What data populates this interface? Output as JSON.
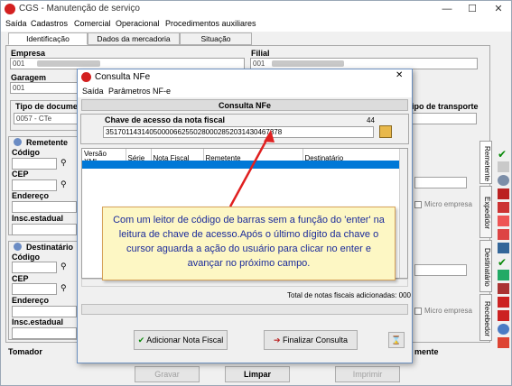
{
  "main_window": {
    "title": "CGS - Manutenção de serviço",
    "menu": [
      "Saída",
      "Cadastros",
      "Comercial",
      "Operacional",
      "Procedimentos auxiliares"
    ],
    "tabs": [
      "Identificação",
      "Dados da mercadoria",
      "Situação"
    ],
    "empresa_label": "Empresa",
    "empresa_value": "001",
    "filial_label": "Filial",
    "filial_value": "001",
    "garagem_label": "Garagem",
    "garagem_value": "001",
    "tipo_documento_label": "Tipo de documen",
    "tipo_documento_value": "0057 - CTe",
    "tipo_transporte_label": "ipo de transporte",
    "remetente_title": "Remetente",
    "destinatario_title": "Destinatário",
    "codigo_label": "Código",
    "cep_label": "CEP",
    "endereco_label": "Endereço",
    "insc_label": "Insc.estadual",
    "micro_empresa_label": "Micro empresa",
    "tomador_label": "Tomador",
    "side_tabs": [
      "Remetente",
      "Expedidor",
      "Destinatário",
      "Recebedor"
    ],
    "buttons": {
      "gravar": "Gravar",
      "limpar": "Limpar",
      "imprimir": "Imprimir"
    }
  },
  "dialog": {
    "title": "Consulta NFe",
    "menu": [
      "Saída",
      "Parâmetros NF-e"
    ],
    "header": "Consulta NFe",
    "chave_label": "Chave de acesso da nota fiscal",
    "chave_count": "44",
    "chave_value": "35170114314050000662550280002852031430467378",
    "columns": [
      "Versão XML",
      "Série",
      "Nota Fiscal",
      "Remetente",
      "Destinatário"
    ],
    "total_label": "Total de notas fiscais adicionadas: 000",
    "buttons": {
      "adicionar": "Adicionar Nota Fiscal",
      "finalizar": "Finalizar Consulta"
    }
  },
  "callout": {
    "text": "Com um leitor de código de barras sem a função do 'enter' na leitura de chave de acesso.Após o último dígito da chave o cursor aguarda a ação do usuário para clicar no enter e avançar no próximo campo."
  }
}
